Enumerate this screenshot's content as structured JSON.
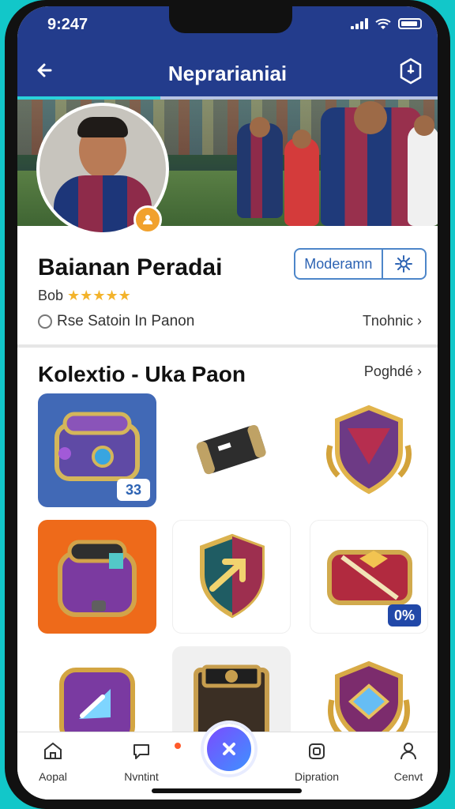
{
  "status_bar": {
    "time": "9:247"
  },
  "header": {
    "title": "Neprarianiai"
  },
  "profile": {
    "name": "Baianan Peradai",
    "rating_text": "Bob",
    "rating_stars": "★★★★★",
    "status_text": "Rse Satoin In Panon",
    "status_link": "Tnohnic",
    "segment_label": "Moderamn"
  },
  "section": {
    "title": "Kolextio - Uka Paon",
    "link": "Poghdé"
  },
  "grid": {
    "badge1": "33",
    "badge2": "0%"
  },
  "bottom_nav": {
    "item1": "Aopal",
    "item2": "Nvntint",
    "item4": "Dipration",
    "item5": "Cenvt"
  },
  "icons": {
    "back": "back-arrow-icon",
    "shield": "shield-icon",
    "settings": "gear-icon",
    "home": "home-icon",
    "chat": "chat-icon",
    "fab": "x-icon",
    "box": "box-icon",
    "user": "user-icon"
  },
  "progress_fraction": 0.34
}
